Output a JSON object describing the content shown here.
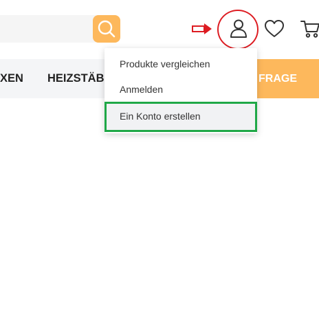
{
  "header": {
    "search_icon": "search-icon",
    "user_icon": "user-icon",
    "wishlist_icon": "heart-icon",
    "cart_icon": "cart-icon"
  },
  "nav": {
    "items": [
      {
        "label": "XEN"
      },
      {
        "label": "HEIZSTÄB"
      }
    ],
    "cta_label": "FRAGE"
  },
  "account_menu": {
    "items": [
      {
        "label": "Produkte vergleichen"
      },
      {
        "label": "Anmelden"
      },
      {
        "label": "Ein Konto erstellen"
      }
    ]
  },
  "colors": {
    "accent": "#fdb85c",
    "annotation_red": "#dd1c22",
    "annotation_green": "#1fa847",
    "nav_background": "#f4f5f7"
  }
}
